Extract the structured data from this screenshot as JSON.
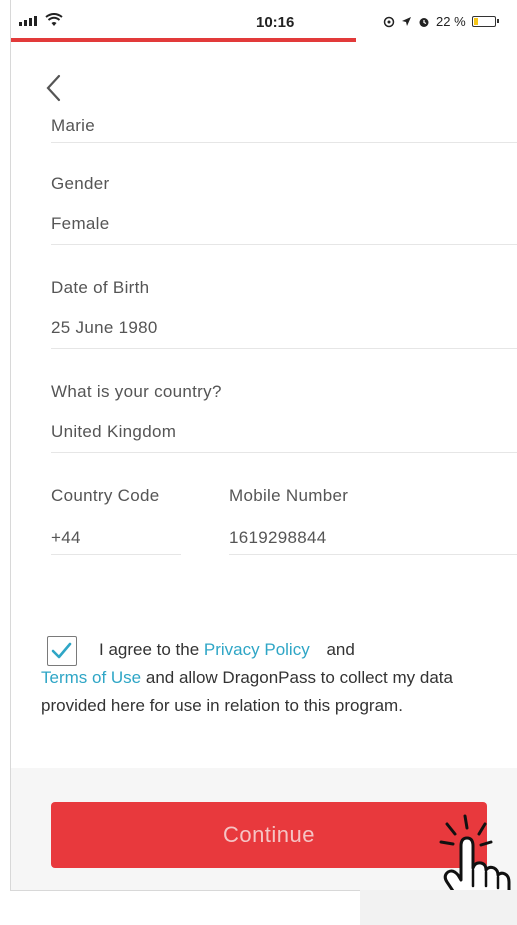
{
  "status_bar": {
    "time": "10:16",
    "right_icons": [
      "alarm-icon",
      "location-icon",
      "clock-icon"
    ],
    "battery_percent_text": "22 %",
    "battery_level": 0.22,
    "load_progress": 0.68,
    "load_color": "#e23a3a"
  },
  "form": {
    "first_name_value": "Marie",
    "gender_label": "Gender",
    "gender_value": "Female",
    "dob_label": "Date of Birth",
    "dob_value": "25 June 1980",
    "country_label": "What is your country?",
    "country_value": "United Kingdom",
    "country_code_label": "Country Code",
    "country_code_value": "+44",
    "mobile_label": "Mobile Number",
    "mobile_value": "1619298844"
  },
  "consent": {
    "checked": true,
    "text_before": "I agree to the ",
    "privacy_link": "Privacy Policy",
    "text_and": " and",
    "terms_link": "Terms of Use",
    "text_after": " and allow DragonPass to collect my data provided here for use in relation to this program."
  },
  "actions": {
    "continue_label": "Continue",
    "accent_color": "#e8393d",
    "link_color": "#2fa6c6"
  }
}
